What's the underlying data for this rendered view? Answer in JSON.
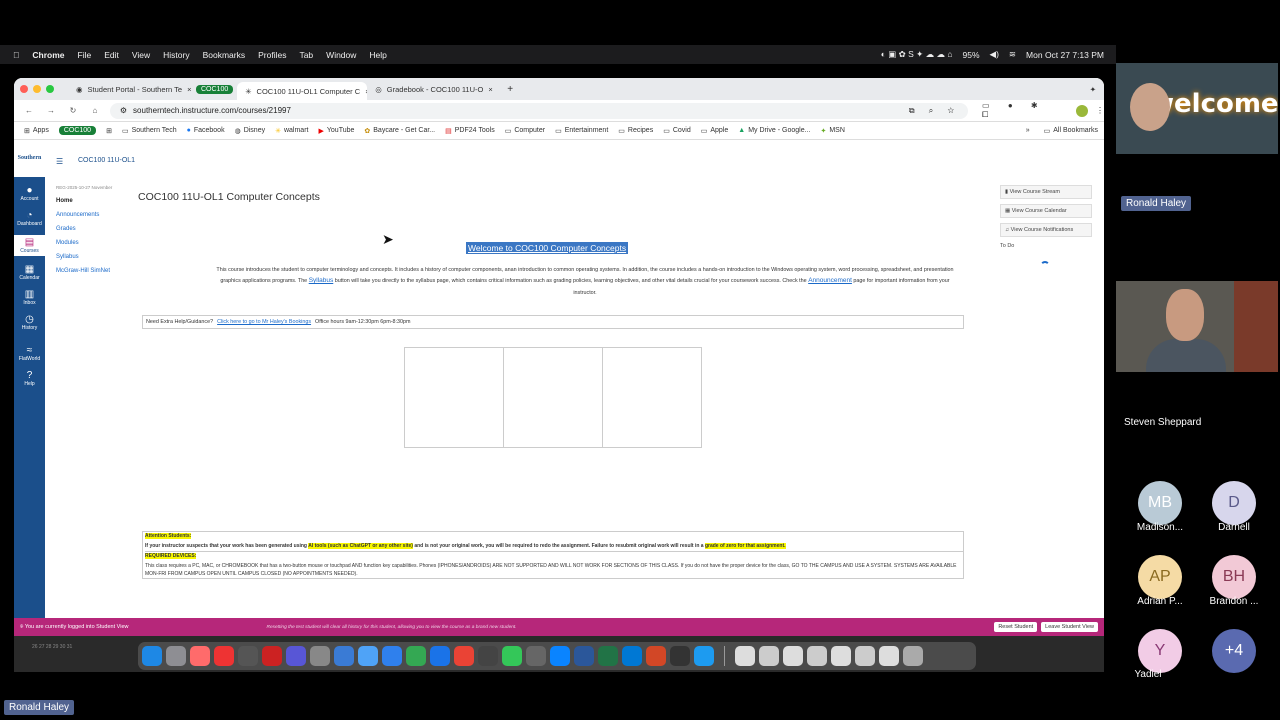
{
  "mac_menubar": {
    "app": "Chrome",
    "items": [
      "File",
      "Edit",
      "View",
      "History",
      "Bookmarks",
      "Profiles",
      "Tab",
      "Window",
      "Help"
    ],
    "battery": "95%",
    "datetime": "Mon Oct 27  7:13 PM"
  },
  "browser": {
    "tabs": [
      {
        "label": "Student Portal - Southern Te",
        "active": false
      },
      {
        "label": "COC100 11U-OL1 Computer C",
        "active": true
      },
      {
        "label": "Gradebook - COC100 11U-O",
        "active": false
      }
    ],
    "tab_group": "COC100",
    "url": "southerntech.instructure.com/courses/21997",
    "bookmarks": [
      "Apps",
      "COC100",
      "Southern Tech",
      "Facebook",
      "Disney",
      "walmart",
      "YouTube",
      "Baycare - Get Car...",
      "PDF24 Tools",
      "Computer",
      "Entertainment",
      "Recipes",
      "Covid",
      "Apple",
      "My Drive - Google...",
      "MSN"
    ],
    "all_bookmarks": "All Bookmarks"
  },
  "canvas": {
    "breadcrumb": "COC100 11U-OL1",
    "logo": "Southern",
    "global_nav": [
      "Account",
      "Dashboard",
      "Courses",
      "Calendar",
      "Inbox",
      "History",
      "FlatWorld",
      "Help"
    ],
    "term": "REG-2025-10-27 November",
    "course_nav": [
      "Home",
      "Announcements",
      "Grades",
      "Modules",
      "Syllabus",
      "McGraw-Hill SimNet"
    ],
    "course_title": "COC100 11U-OL1 Computer Concepts",
    "welcome": "Welcome to COC100 Computer Concepts",
    "intro_a": "This course introduces the student to computer terminology and concepts. It includes a history of computer components, anan introduction to common operating systems. In addition, the course includes a hands-on introduction to the Windows operating system, word processing, spreadsheet, and presentation graphics applications programs. The",
    "intro_syllabus": "Syllabus",
    "intro_b": "button will take you directly to the syllabus page, which contains critical information such as grading policies, learning objectives, and other vital details crucial for your coursework success. Check the",
    "intro_announcement": "Announcement",
    "intro_c": "page for important information from your instructor.",
    "help_label": "Need Extra Help/Guidance?",
    "help_link": "Click here to go to Mr Haley's Bookings",
    "help_hours": "Office hours 9am-12:30pm 6pm-8:30pm",
    "attention_title": "Attention Students:",
    "attention_a": "If your instructor suspects that your work has been generated using",
    "attention_hl1": "AI tools (such as ChatGPT or any other site)",
    "attention_b": "and is not your original work, you will be required to redo the assignment. Failure to resubmit original work will result in a",
    "attention_hl2": "grade of zero for that assignment.",
    "devices_title": "REQUIRED DEVICES:",
    "devices_text": "This class requires a PC, MAC, or CHROMEBOOK that has a two-button mouse or touchpad AND function key capabilities. Phones (IPHONES/ANDROIDS) ARE NOT SUPPORTED AND WILL NOT WORK FOR SECTIONS OF THIS CLASS. If you do not have the proper device for the class, GO TO THE CAMPUS AND USE A SYSTEM. SYSTEMS ARE AVAILABLE MON-FRI FROM CAMPUS OPEN UNTIL CAMPUS CLOSED (NO APPOINTMENTS NEEDED).",
    "right_buttons": [
      "View Course Stream",
      "View Course Calendar",
      "View Course Notifications"
    ],
    "todo": "To Do"
  },
  "student_view": {
    "left": "You are currently logged into Student View",
    "mid": "Resetting the test student will clear all history for this student, allowing you to view the course as a brand new student.",
    "reset": "Reset Student",
    "leave": "Leave Student View"
  },
  "dock_calendar": "26  27  28  29  30  31",
  "meeting": {
    "speaker1": "Ronald Haley",
    "welcome_text": "welcome",
    "speaker2": "Steven Sheppard",
    "participants": [
      {
        "initials": "MB",
        "name": "Madison...",
        "color": "#b9cad6"
      },
      {
        "initials": "D",
        "name": "Darnell",
        "color": "#d7d6ec"
      },
      {
        "initials": "AP",
        "name": "Adrian P...",
        "color": "#f5dba5"
      },
      {
        "initials": "BH",
        "name": "Brandon ...",
        "color": "#f2c9d6"
      },
      {
        "initials": "Y",
        "name": "Yadiel",
        "color": "#f2cce6"
      }
    ],
    "more": "+4",
    "self_name": "Ronald Haley"
  }
}
